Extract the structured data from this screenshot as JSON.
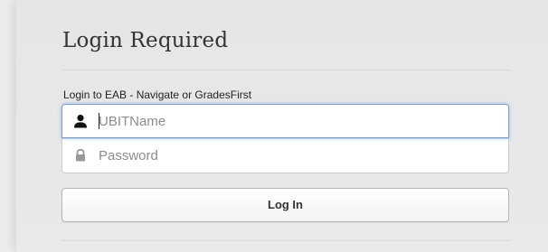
{
  "header": {
    "title": "Login Required"
  },
  "form": {
    "label": "Login to EAB - Navigate or GradesFirst",
    "username": {
      "placeholder": "UBITName",
      "value": "",
      "icon": "user-icon",
      "focused": true
    },
    "password": {
      "placeholder": "Password",
      "value": "",
      "icon": "lock-icon"
    },
    "submit_label": "Log In"
  },
  "colors": {
    "background": "#e6e6e6",
    "focus_border": "#6f9fd8",
    "text": "#333333"
  }
}
